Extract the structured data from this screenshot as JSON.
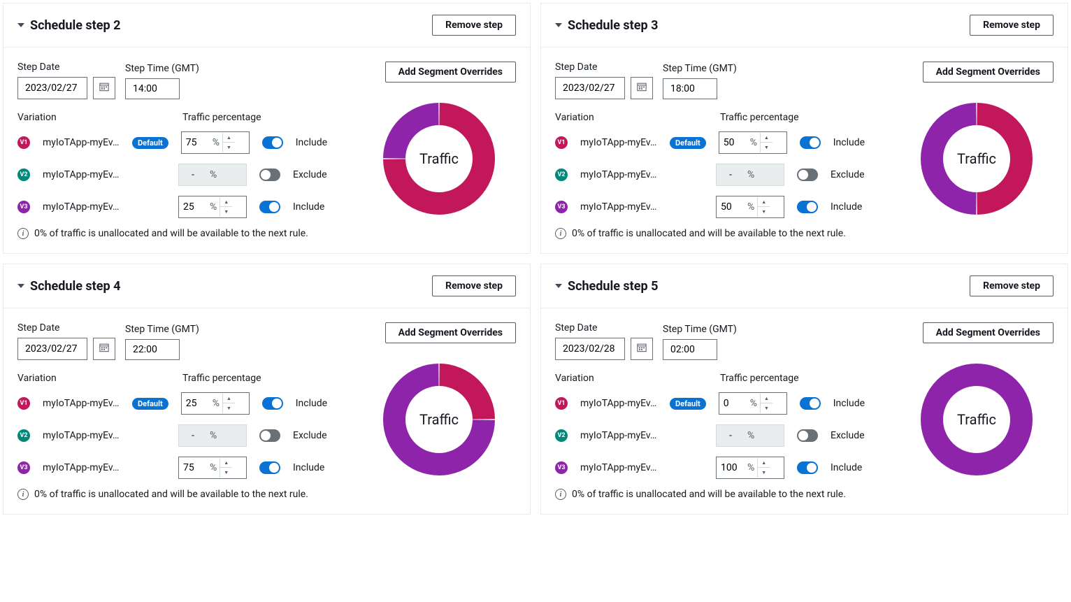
{
  "labels": {
    "step_date": "Step Date",
    "step_time": "Step Time (GMT)",
    "variation": "Variation",
    "traffic_pct": "Traffic percentage",
    "remove_step": "Remove step",
    "add_seg": "Add Segment Overrides",
    "include": "Include",
    "exclude": "Exclude",
    "default": "Default",
    "traffic": "Traffic",
    "info": "0% of traffic is unallocated and will be available to the next rule.",
    "pct": "%",
    "dash": "-"
  },
  "variation_badges": [
    "V1",
    "V2",
    "V3"
  ],
  "steps": [
    {
      "title": "Schedule step 2",
      "date": "2023/02/27",
      "time": "14:00",
      "variations": [
        {
          "name": "myIoTApp-myEv…",
          "default": true,
          "pct": "75",
          "included": true
        },
        {
          "name": "myIoTApp-myEv…",
          "default": false,
          "pct": null,
          "included": false
        },
        {
          "name": "myIoTApp-myEv…",
          "default": false,
          "pct": "25",
          "included": true
        }
      ],
      "chart_data": {
        "type": "pie",
        "title": "Traffic",
        "series": [
          {
            "name": "V1",
            "value": 75,
            "color": "#c2185b"
          },
          {
            "name": "V3",
            "value": 25,
            "color": "#8e24aa"
          }
        ]
      }
    },
    {
      "title": "Schedule step 3",
      "date": "2023/02/27",
      "time": "18:00",
      "variations": [
        {
          "name": "myIoTApp-myEv…",
          "default": true,
          "pct": "50",
          "included": true
        },
        {
          "name": "myIoTApp-myEv…",
          "default": false,
          "pct": null,
          "included": false
        },
        {
          "name": "myIoTApp-myEv…",
          "default": false,
          "pct": "50",
          "included": true
        }
      ],
      "chart_data": {
        "type": "pie",
        "title": "Traffic",
        "series": [
          {
            "name": "V1",
            "value": 50,
            "color": "#c2185b"
          },
          {
            "name": "V3",
            "value": 50,
            "color": "#8e24aa"
          }
        ]
      }
    },
    {
      "title": "Schedule step 4",
      "date": "2023/02/27",
      "time": "22:00",
      "variations": [
        {
          "name": "myIoTApp-myEv…",
          "default": true,
          "pct": "25",
          "included": true
        },
        {
          "name": "myIoTApp-myEv…",
          "default": false,
          "pct": null,
          "included": false
        },
        {
          "name": "myIoTApp-myEv…",
          "default": false,
          "pct": "75",
          "included": true
        }
      ],
      "chart_data": {
        "type": "pie",
        "title": "Traffic",
        "series": [
          {
            "name": "V1",
            "value": 25,
            "color": "#c2185b"
          },
          {
            "name": "V3",
            "value": 75,
            "color": "#8e24aa"
          }
        ]
      }
    },
    {
      "title": "Schedule step 5",
      "date": "2023/02/28",
      "time": "02:00",
      "variations": [
        {
          "name": "myIoTApp-myEv…",
          "default": true,
          "pct": "0",
          "included": true
        },
        {
          "name": "myIoTApp-myEv…",
          "default": false,
          "pct": null,
          "included": false
        },
        {
          "name": "myIoTApp-myEv…",
          "default": false,
          "pct": "100",
          "included": true
        }
      ],
      "chart_data": {
        "type": "pie",
        "title": "Traffic",
        "series": [
          {
            "name": "V1",
            "value": 0,
            "color": "#c2185b"
          },
          {
            "name": "V3",
            "value": 100,
            "color": "#8e24aa"
          }
        ]
      }
    }
  ]
}
